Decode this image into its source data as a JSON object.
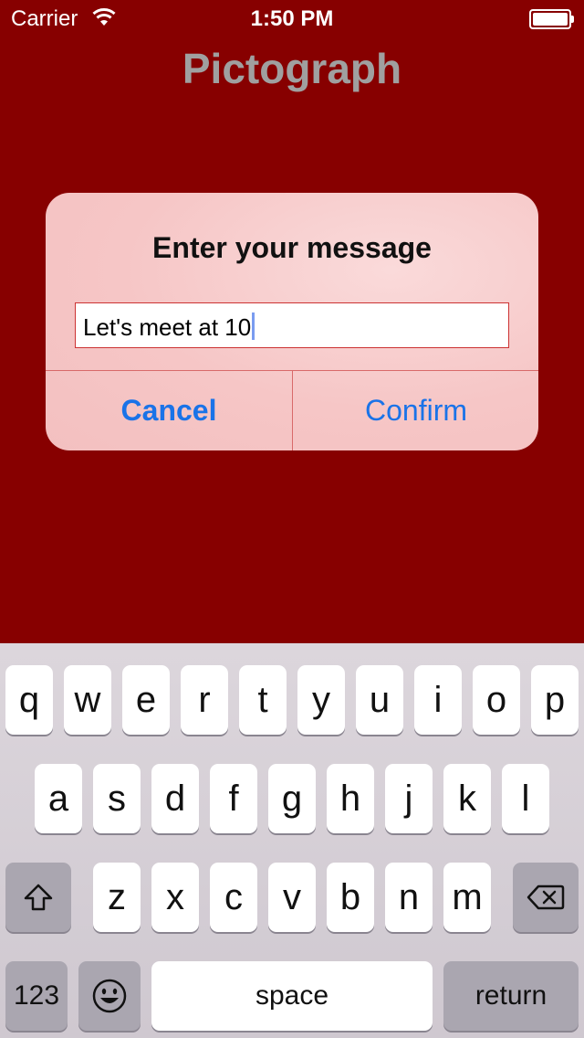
{
  "status_bar": {
    "carrier": "Carrier",
    "time": "1:50 PM"
  },
  "app": {
    "title": "Pictograph",
    "background_color": "#870000"
  },
  "alert": {
    "title": "Enter your message",
    "input_value": "Let's meet at 10",
    "cancel_label": "Cancel",
    "confirm_label": "Confirm",
    "button_color": "#1a73e8"
  },
  "keyboard": {
    "row1": [
      "q",
      "w",
      "e",
      "r",
      "t",
      "y",
      "u",
      "i",
      "o",
      "p"
    ],
    "row2": [
      "a",
      "s",
      "d",
      "f",
      "g",
      "h",
      "j",
      "k",
      "l"
    ],
    "row3": [
      "z",
      "x",
      "c",
      "v",
      "b",
      "n",
      "m"
    ],
    "numbers_label": "123",
    "space_label": "space",
    "return_label": "return",
    "icons": [
      "shift-icon",
      "backspace-icon",
      "emoji-icon"
    ]
  }
}
